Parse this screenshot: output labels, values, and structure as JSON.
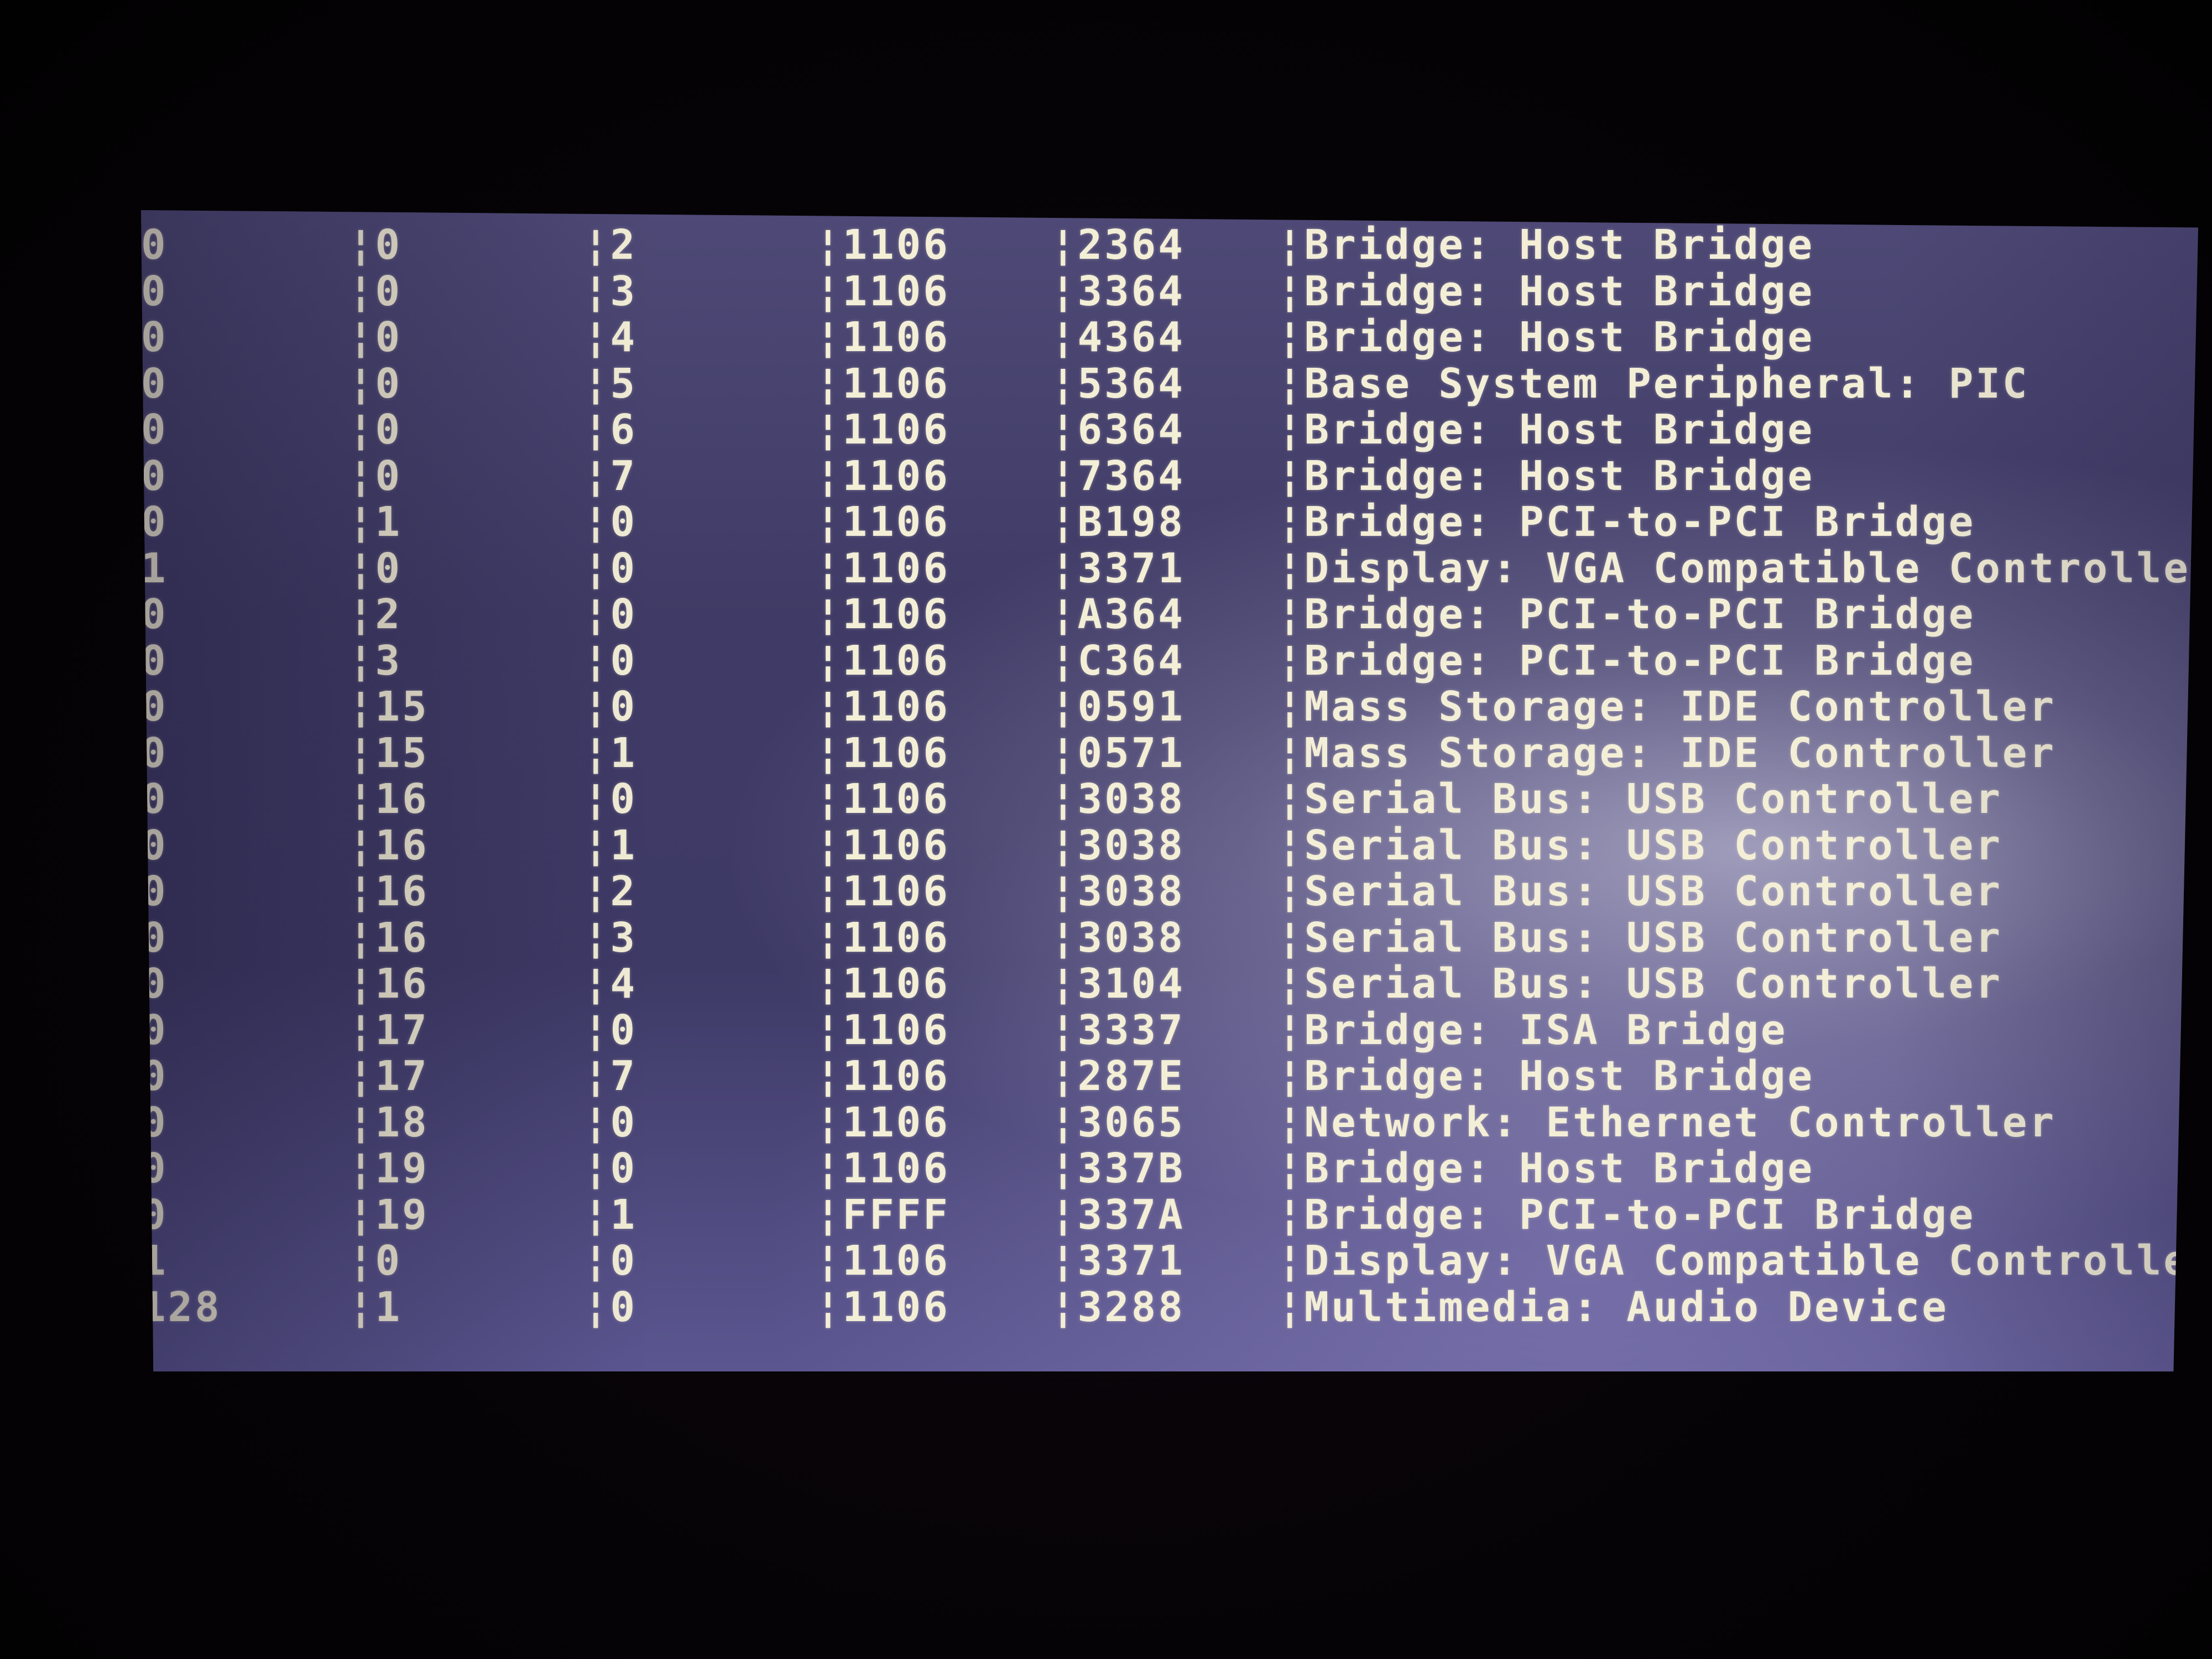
{
  "columns_separator": "¦",
  "rows": [
    {
      "bus": "0",
      "device": "¦0",
      "function": "¦2",
      "vendor": "¦1106",
      "device_id": "¦2364",
      "class": "¦Bridge: Host Bridge"
    },
    {
      "bus": "0",
      "device": "¦0",
      "function": "¦3",
      "vendor": "¦1106",
      "device_id": "¦3364",
      "class": "¦Bridge: Host Bridge"
    },
    {
      "bus": "0",
      "device": "¦0",
      "function": "¦4",
      "vendor": "¦1106",
      "device_id": "¦4364",
      "class": "¦Bridge: Host Bridge"
    },
    {
      "bus": "0",
      "device": "¦0",
      "function": "¦5",
      "vendor": "¦1106",
      "device_id": "¦5364",
      "class": "¦Base System Peripheral: PIC"
    },
    {
      "bus": "0",
      "device": "¦0",
      "function": "¦6",
      "vendor": "¦1106",
      "device_id": "¦6364",
      "class": "¦Bridge: Host Bridge"
    },
    {
      "bus": "0",
      "device": "¦0",
      "function": "¦7",
      "vendor": "¦1106",
      "device_id": "¦7364",
      "class": "¦Bridge: Host Bridge"
    },
    {
      "bus": "0",
      "device": "¦1",
      "function": "¦0",
      "vendor": "¦1106",
      "device_id": "¦B198",
      "class": "¦Bridge: PCI-to-PCI Bridge"
    },
    {
      "bus": "1",
      "device": "¦0",
      "function": "¦0",
      "vendor": "¦1106",
      "device_id": "¦3371",
      "class": "¦Display: VGA Compatible Controller"
    },
    {
      "bus": "0",
      "device": "¦2",
      "function": "¦0",
      "vendor": "¦1106",
      "device_id": "¦A364",
      "class": "¦Bridge: PCI-to-PCI Bridge"
    },
    {
      "bus": "0",
      "device": "¦3",
      "function": "¦0",
      "vendor": "¦1106",
      "device_id": "¦C364",
      "class": "¦Bridge: PCI-to-PCI Bridge"
    },
    {
      "bus": "0",
      "device": "¦15",
      "function": "¦0",
      "vendor": "¦1106",
      "device_id": "¦0591",
      "class": "¦Mass Storage: IDE Controller"
    },
    {
      "bus": "0",
      "device": "¦15",
      "function": "¦1",
      "vendor": "¦1106",
      "device_id": "¦0571",
      "class": "¦Mass Storage: IDE Controller"
    },
    {
      "bus": "0",
      "device": "¦16",
      "function": "¦0",
      "vendor": "¦1106",
      "device_id": "¦3038",
      "class": "¦Serial Bus: USB Controller"
    },
    {
      "bus": "0",
      "device": "¦16",
      "function": "¦1",
      "vendor": "¦1106",
      "device_id": "¦3038",
      "class": "¦Serial Bus: USB Controller"
    },
    {
      "bus": "0",
      "device": "¦16",
      "function": "¦2",
      "vendor": "¦1106",
      "device_id": "¦3038",
      "class": "¦Serial Bus: USB Controller"
    },
    {
      "bus": "0",
      "device": "¦16",
      "function": "¦3",
      "vendor": "¦1106",
      "device_id": "¦3038",
      "class": "¦Serial Bus: USB Controller"
    },
    {
      "bus": "0",
      "device": "¦16",
      "function": "¦4",
      "vendor": "¦1106",
      "device_id": "¦3104",
      "class": "¦Serial Bus: USB Controller"
    },
    {
      "bus": "0",
      "device": "¦17",
      "function": "¦0",
      "vendor": "¦1106",
      "device_id": "¦3337",
      "class": "¦Bridge: ISA Bridge"
    },
    {
      "bus": "0",
      "device": "¦17",
      "function": "¦7",
      "vendor": "¦1106",
      "device_id": "¦287E",
      "class": "¦Bridge: Host Bridge"
    },
    {
      "bus": "0",
      "device": "¦18",
      "function": "¦0",
      "vendor": "¦1106",
      "device_id": "¦3065",
      "class": "¦Network: Ethernet Controller"
    },
    {
      "bus": "0",
      "device": "¦19",
      "function": "¦0",
      "vendor": "¦1106",
      "device_id": "¦337B",
      "class": "¦Bridge: Host Bridge"
    },
    {
      "bus": "0",
      "device": "¦19",
      "function": "¦1",
      "vendor": "¦FFFF",
      "device_id": "¦337A",
      "class": "¦Bridge: PCI-to-PCI Bridge"
    },
    {
      "bus": "1",
      "device": "¦0",
      "function": "¦0",
      "vendor": "¦1106",
      "device_id": "¦3371",
      "class": "¦Display: VGA Compatible Controller"
    },
    {
      "bus": "128",
      "device": "¦1",
      "function": "¦0",
      "vendor": "¦1106",
      "device_id": "¦3288",
      "class": "¦Multimedia: Audio Device"
    }
  ],
  "colors": {
    "screen_bg": "#403b66",
    "text": "#f3eed6",
    "bezel": "#050205"
  }
}
